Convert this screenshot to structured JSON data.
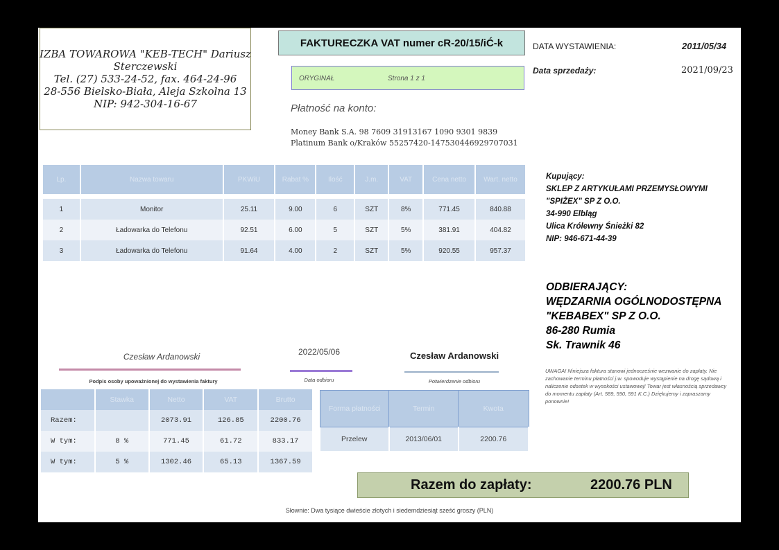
{
  "seller": {
    "lines": [
      "IZBA TOWAROWA \"KEB-TECH\" Dariusz",
      "Sterczewski",
      "Tel. (27) 533-24-52, fax. 464-24-96",
      "28-556 Bielsko-Biała, Aleja Szkolna 13",
      "NIP: 942-304-16-67"
    ]
  },
  "invoice": {
    "title": "FAKTURECZKA  VAT numer  cR-20/15/iĆ-k",
    "original": "ORYGINAŁ",
    "page": "Strona 1 z 1",
    "issue_label": "DATA WYSTAWIENIA:",
    "issue_date": "2011/05/34",
    "sale_label": "Data sprzedaży:",
    "sale_date": "2021/09/23"
  },
  "payment": {
    "title": "Płatność na konto:",
    "bank1": "Money Bank S.A. 98 7609 31913167  1090 9301 9839",
    "bank2": "Platinum  Bank  o/Kraków  55257420-147530446929707031"
  },
  "items": {
    "headers": [
      "Lp.",
      "Nazwa towaru",
      "PKWiU",
      "Rabat %",
      "Ilość",
      "J.m.",
      "VAT",
      "Cena netto",
      "Wart. netto"
    ],
    "rows": [
      [
        "1",
        "Monitor",
        "25.11",
        "9.00",
        "6",
        "SZT",
        "8%",
        "771.45",
        "840.88"
      ],
      [
        "2",
        "Ładowarka do Telefonu",
        "92.51",
        "6.00",
        "5",
        "SZT",
        "5%",
        "381.91",
        "404.82"
      ],
      [
        "3",
        "Ładowarka do Telefonu",
        "91.64",
        "4.00",
        "2",
        "SZT",
        "5%",
        "920.55",
        "957.37"
      ]
    ]
  },
  "buyer": {
    "lines": [
      "Kupujący:",
      "SKLEP Z ARTYKUŁAMI PRZEMYSŁOWYMI",
      "\"SPIŻEX\" SP Z O.O.",
      "34-990 Elbląg",
      "Ulica Królewny Śnieżki  82",
      "NIP: 946-671-44-39"
    ]
  },
  "receiver": {
    "lines": [
      "ODBIERAJĄCY:",
      "WĘDZARNIA  OGÓLNODOSTĘPNA",
      "\"KEBABEX\" SP Z O.O.",
      "86-280 Rumia",
      "Sk.  Trawnik  46"
    ]
  },
  "note": "UWAGA! Niniejsza faktura stanowi jednocześnie wezwanie do zapłaty. Nie zachowanie terminu płatności j.w. spowoduje wystąpienie na drogę sądową i naliczenie odsetek w wysokości ustawowej! Towar jest własnością sprzedawcy do momentu zapłaty (Art. 589, 590, 591 K.C.) Dziękujemy i zapraszamy ponownie!",
  "signatures": {
    "issuer_name": "Czesław Ardanowski",
    "issuer_label": "Podpis osoby upoważnionej do wystawienia faktury",
    "date": "2022/05/06",
    "date_label": "Data odbioru",
    "receiver_name": "Czesław Ardanowski",
    "receiver_label": "Potwierdzenie odbioru"
  },
  "summary": {
    "headers": [
      "",
      "Stawka",
      "Netto",
      "VAT",
      "Brutto"
    ],
    "rows": [
      [
        "Razem:",
        "",
        "2073.91",
        "126.85",
        "2200.76"
      ],
      [
        "W tym:",
        "8 %",
        "771.45",
        "61.72",
        "833.17"
      ],
      [
        "W tym:",
        "5 %",
        "1302.46",
        "65.13",
        "1367.59"
      ]
    ]
  },
  "payment_terms": {
    "headers": [
      "Forma płatności",
      "Termin",
      "Kwota"
    ],
    "row": [
      "Przelew",
      "2013/06/01",
      "2200.76"
    ]
  },
  "total": {
    "label": "Razem do zapłaty:",
    "amount": "2200.76 PLN"
  },
  "in_words": "Słownie: Dwa tysiące dwieście złotych i siedemdziesiąt sześć groszy (PLN)"
}
